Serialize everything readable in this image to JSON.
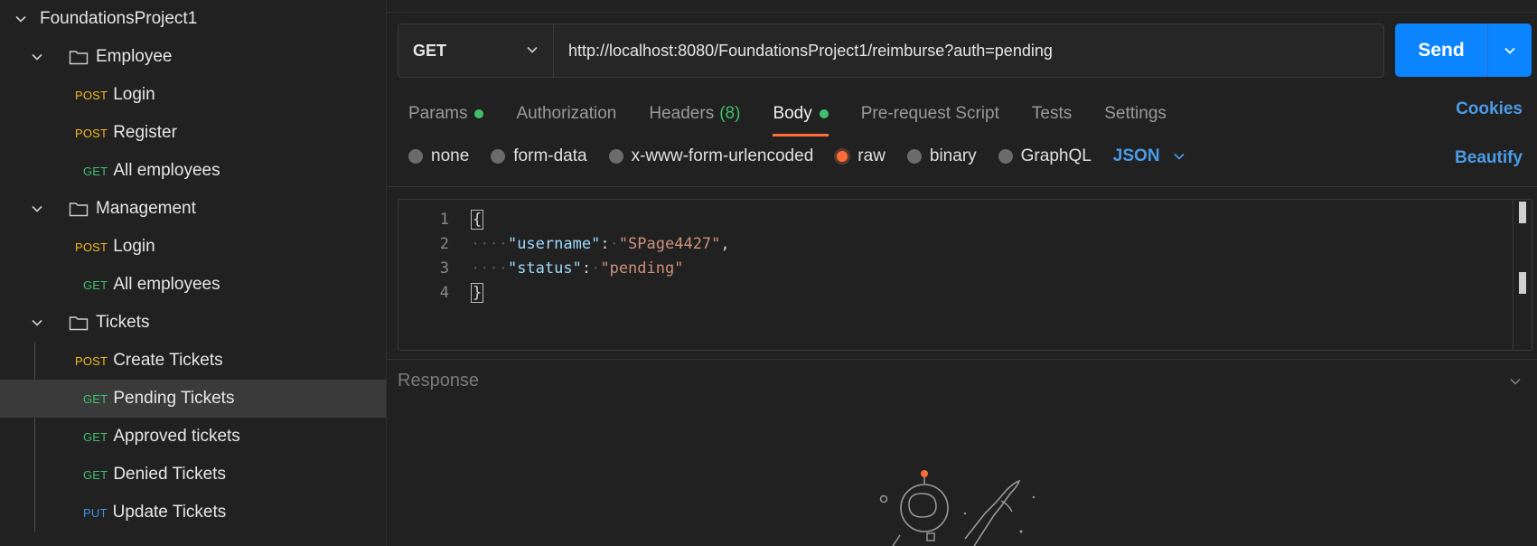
{
  "sidebar": {
    "collection": "FoundationsProject1",
    "items": [
      {
        "type": "folder",
        "label": "Employee"
      },
      {
        "type": "request",
        "method": "POST",
        "label": "Login"
      },
      {
        "type": "request",
        "method": "POST",
        "label": "Register"
      },
      {
        "type": "request",
        "method": "GET",
        "label": "All employees"
      },
      {
        "type": "folder",
        "label": "Management"
      },
      {
        "type": "request",
        "method": "POST",
        "label": "Login"
      },
      {
        "type": "request",
        "method": "GET",
        "label": "All employees"
      },
      {
        "type": "folder",
        "label": "Tickets"
      },
      {
        "type": "request",
        "method": "POST",
        "label": "Create Tickets"
      },
      {
        "type": "request",
        "method": "GET",
        "label": "Pending Tickets",
        "selected": true
      },
      {
        "type": "request",
        "method": "GET",
        "label": "Approved tickets"
      },
      {
        "type": "request",
        "method": "GET",
        "label": "Denied Tickets"
      },
      {
        "type": "request",
        "method": "PUT",
        "label": "Update Tickets"
      }
    ]
  },
  "request": {
    "method": "GET",
    "url": "http://localhost:8080/FoundationsProject1/reimburse?auth=pending",
    "send_label": "Send"
  },
  "tabs": {
    "params": "Params",
    "authorization": "Authorization",
    "headers": "Headers",
    "headers_count": "(8)",
    "body": "Body",
    "prerequest": "Pre-request Script",
    "tests": "Tests",
    "settings": "Settings",
    "cookies": "Cookies"
  },
  "body_types": {
    "none": "none",
    "form_data": "form-data",
    "urlencoded": "x-www-form-urlencoded",
    "raw": "raw",
    "binary": "binary",
    "graphql": "GraphQL",
    "language": "JSON",
    "beautify": "Beautify",
    "selected": "raw"
  },
  "editor": {
    "line_numbers": [
      "1",
      "2",
      "3",
      "4"
    ],
    "open_brace": "{",
    "close_brace": "}",
    "key1": "\"username\"",
    "value1": "\"SPage4427\"",
    "key2": "\"status\"",
    "value2": "\"pending\""
  },
  "response": {
    "title": "Response"
  },
  "colors": {
    "accent": "#0a84ff",
    "orange": "#ff6c37",
    "post": "#f2b824",
    "get": "#3fbf6c",
    "put": "#3f8fe8",
    "link": "#4b9be8"
  }
}
